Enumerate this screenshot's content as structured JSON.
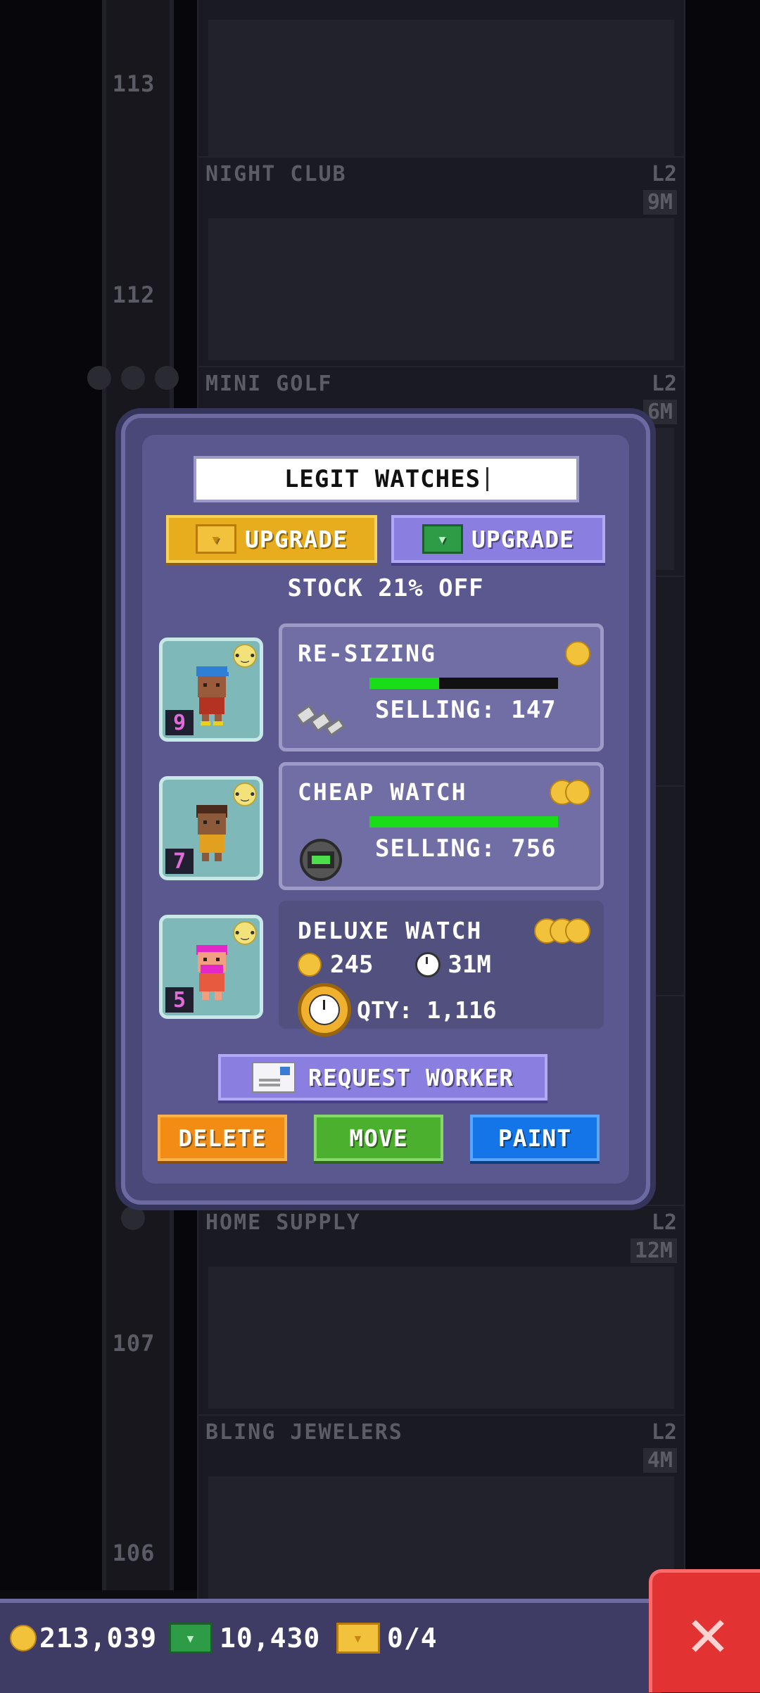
{
  "background": {
    "floors": [
      {
        "number": "113",
        "name": "",
        "level": "",
        "value": ""
      },
      {
        "number": "112",
        "name": "NIGHT CLUB",
        "level": "L2",
        "value": "9M"
      },
      {
        "number": "",
        "name": "MINI GOLF",
        "level": "L2",
        "value": "6M"
      },
      {
        "number": "107",
        "name": "HOME SUPPLY",
        "level": "L2",
        "value": "12M"
      },
      {
        "number": "106",
        "name": "BLING JEWELERS",
        "level": "L2",
        "value": "4M"
      }
    ]
  },
  "dialog": {
    "store_name": "LEGIT WATCHES",
    "upgrade_gold_label": "UPGRADE",
    "upgrade_bux_label": "UPGRADE",
    "stock_discount": "STOCK 21% OFF",
    "workers": [
      {
        "level": "9",
        "mood": "neutral"
      },
      {
        "level": "7",
        "mood": "neutral"
      },
      {
        "level": "5",
        "mood": "neutral"
      }
    ],
    "stocks": [
      {
        "name": "RE-SIZING",
        "tier_coins": 1,
        "status": "SELLING: 147",
        "progress": 0.37
      },
      {
        "name": "CHEAP WATCH",
        "tier_coins": 2,
        "status": "SELLING: 756",
        "progress": 1.0
      },
      {
        "name": "DELUXE WATCH",
        "tier_coins": 3,
        "cost": "245",
        "time": "31M",
        "qty": "QTY: 1,116"
      }
    ],
    "request_worker_label": "REQUEST WORKER",
    "delete_label": "DELETE",
    "move_label": "MOVE",
    "paint_label": "PAINT"
  },
  "status_bar": {
    "coins": "213,039",
    "bux": "10,430",
    "golden_tickets": "0/4"
  },
  "colors": {
    "dialog_bg": "#5b5890",
    "progress_fill": "#19dd19",
    "close_button": "#e23232"
  }
}
